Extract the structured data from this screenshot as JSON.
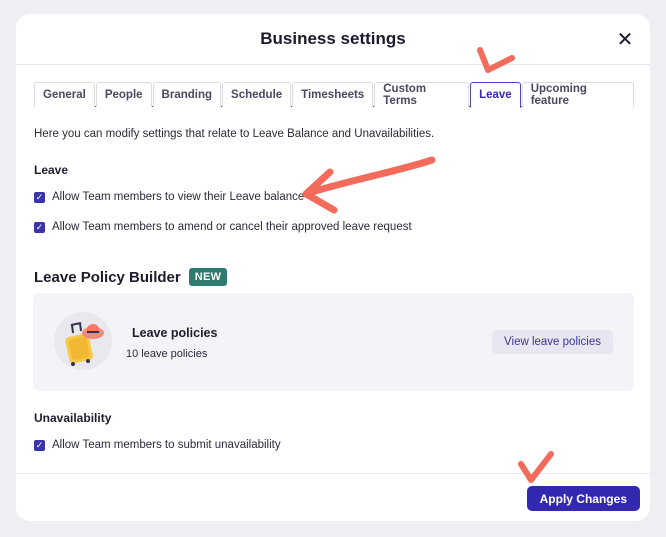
{
  "modal": {
    "title": "Business settings",
    "close_icon": "close-icon"
  },
  "tabs": [
    {
      "label": "General",
      "active": false
    },
    {
      "label": "People",
      "active": false
    },
    {
      "label": "Branding",
      "active": false
    },
    {
      "label": "Schedule",
      "active": false
    },
    {
      "label": "Timesheets",
      "active": false
    },
    {
      "label": "Custom Terms",
      "active": false
    },
    {
      "label": "Leave",
      "active": true
    },
    {
      "label": "Upcoming feature",
      "active": false
    }
  ],
  "intro_text": "Here you can modify settings that relate to Leave Balance and Unavailabilities.",
  "leave": {
    "heading": "Leave",
    "options": [
      {
        "label": "Allow Team members to view their Leave balance",
        "checked": true
      },
      {
        "label": "Allow Team members to amend or cancel their approved leave request",
        "checked": true
      }
    ]
  },
  "policy_builder": {
    "heading": "Leave Policy Builder",
    "badge": "NEW",
    "card": {
      "icon": "suitcase-icon",
      "title": "Leave policies",
      "subtitle": "10 leave policies",
      "button": "View leave policies"
    }
  },
  "unavailability": {
    "heading": "Unavailability",
    "options": [
      {
        "label": "Allow Team members to submit unavailability",
        "checked": true
      }
    ]
  },
  "footer": {
    "apply_button": "Apply Changes"
  },
  "colors": {
    "accent": "#3328b0",
    "badge": "#2f7b70",
    "annotation": "#f26b5b"
  }
}
